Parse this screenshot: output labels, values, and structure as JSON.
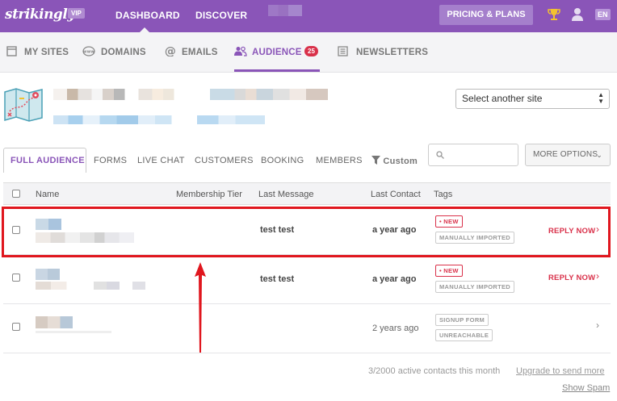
{
  "topbar": {
    "logo": "strikingly",
    "vip": "VIP",
    "nav": [
      "DASHBOARD",
      "DISCOVER"
    ],
    "pricing_label": "PRICING & PLANS",
    "lang": "EN",
    "brand_color": "#8a55b8"
  },
  "subnav": {
    "items": [
      {
        "label": "MY SITES",
        "icon": "window-icon"
      },
      {
        "label": "DOMAINS",
        "icon": "www-icon"
      },
      {
        "label": "EMAILS",
        "icon": "at-icon"
      },
      {
        "label": "AUDIENCE",
        "icon": "people-icon",
        "active": true,
        "badge": "25"
      },
      {
        "label": "NEWSLETTERS",
        "icon": "newsletter-icon"
      }
    ]
  },
  "site": {
    "select_label": "Select another site"
  },
  "tabs": {
    "items": [
      "FULL AUDIENCE",
      "FORMS",
      "LIVE CHAT",
      "CUSTOMERS",
      "BOOKING",
      "MEMBERS"
    ],
    "custom": "Custom",
    "more_options": "MORE OPTIONS"
  },
  "table": {
    "headers": [
      "Name",
      "Membership Tier",
      "Last Message",
      "Last Contact",
      "Tags"
    ],
    "rows": [
      {
        "message": "test test",
        "contact": "a year ago",
        "tags": [
          "• NEW",
          "MANUALLY IMPORTED"
        ],
        "action": "REPLY NOW"
      },
      {
        "message": "test test",
        "contact": "a year ago",
        "tags": [
          "• NEW",
          "MANUALLY IMPORTED"
        ],
        "action": "REPLY NOW"
      },
      {
        "message": "",
        "contact": "2 years ago",
        "tags": [
          "SIGNUP FORM",
          "UNREACHABLE"
        ],
        "action": ""
      }
    ]
  },
  "footer": {
    "contacts_text": "3/2000 active contacts this month",
    "upgrade_link": "Upgrade to send more",
    "spam_link": "Show Spam"
  }
}
